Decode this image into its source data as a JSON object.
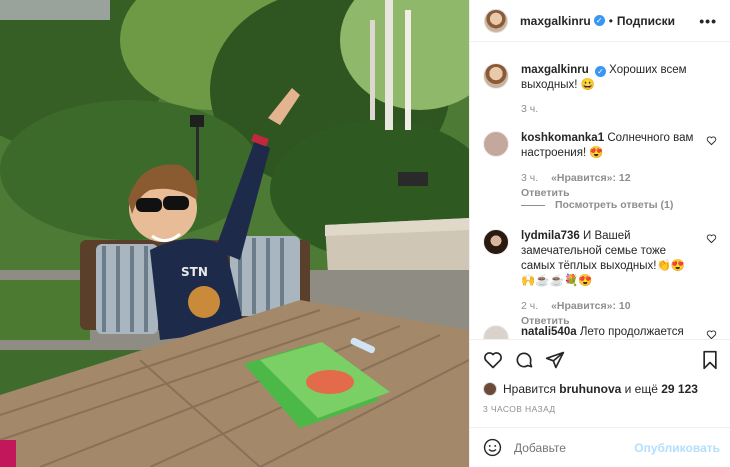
{
  "post": {
    "username": "maxgalkinru",
    "verified_mark": "✓",
    "separator": "•",
    "follow_label": "Подписки",
    "more_icon": "more-dots-icon"
  },
  "caption": {
    "username": "maxgalkinru",
    "text": "Хороших всем выходных! 😀",
    "time": "3 ч."
  },
  "comments": [
    {
      "username": "koshkomanka1",
      "text": "Солнечного вам настроения! 😍",
      "time": "3 ч.",
      "likes": "«Нравится»: 12",
      "reply": "Ответить",
      "avatar_color": "#c4a8a0"
    },
    {
      "username": "lydmila736",
      "text": "И Вашей замечательной семье тоже самых тёплых выходных!👏😍🙌☕☕💐😍",
      "time": "2 ч.",
      "likes": "«Нравится»: 10",
      "reply": "Ответить",
      "avatar_color": "#3b2a20"
    },
    {
      "username": "natali540a",
      "text": "Лето продолжается",
      "avatar_color": "#d9d3cc"
    }
  ],
  "view_replies": "Посмотреть ответы (1)",
  "actions": {
    "like_icon": "heart-icon",
    "comment_icon": "comment-icon",
    "share_icon": "paper-plane-icon",
    "save_icon": "bookmark-icon"
  },
  "likes": {
    "prefix": "Нравится",
    "user": "bruhunova",
    "suffix": "и ещё",
    "count": "29 123"
  },
  "posted": "3 ЧАСОВ НАЗАД",
  "add_comment": {
    "placeholder": "Добавьте",
    "publish_label": "Опубликовать"
  },
  "colors": {
    "accent": "#3897f0",
    "publish_disabled": "#b2dffc",
    "muted": "#8e8e8e"
  }
}
